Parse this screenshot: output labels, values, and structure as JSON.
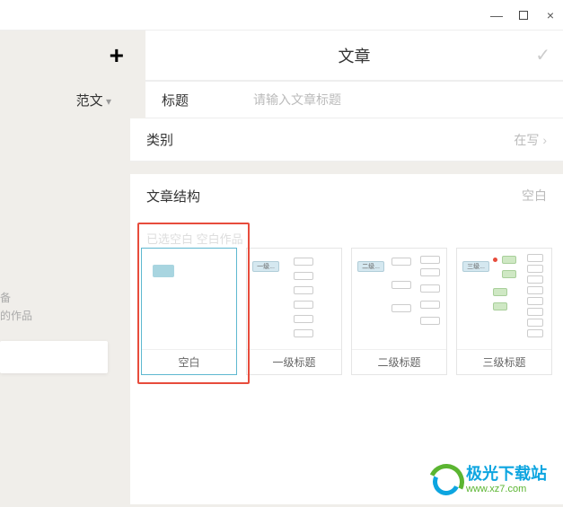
{
  "titlebar": {
    "minimize": "—",
    "close": "×"
  },
  "header": {
    "tab_label": "文章"
  },
  "sidebar": {
    "dropdown": "范文",
    "hint_line1": "备",
    "hint_line2": "的作品"
  },
  "form": {
    "title_label": "标题",
    "title_placeholder": "请输入文章标题",
    "category_label": "类别",
    "category_value": "在写"
  },
  "structure": {
    "title": "文章结构",
    "value": "空白",
    "selected_hint": "已选空白 空白作品"
  },
  "templates": [
    {
      "label": "空白",
      "root_text": ""
    },
    {
      "label": "一级标题",
      "root_text": "一级..."
    },
    {
      "label": "二级标题",
      "root_text": "二级..."
    },
    {
      "label": "三级标题",
      "root_text": "三级..."
    }
  ],
  "watermark": {
    "name": "极光下载站",
    "url": "www.xz7.com"
  }
}
